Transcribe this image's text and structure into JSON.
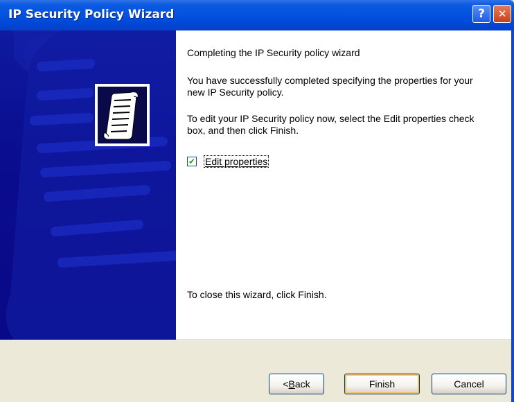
{
  "window": {
    "title": "IP Security Policy Wizard",
    "help_glyph": "?",
    "close_glyph": "✕"
  },
  "content": {
    "heading": "Completing the IP Security policy wizard",
    "paragraph1": "You have successfully completed specifying the properties for your new IP Security policy.",
    "paragraph2": "To edit your IP Security policy now, select the Edit properties check box, and then click Finish.",
    "checkbox": {
      "label": "Edit properties",
      "checked": true,
      "mark": "✔"
    },
    "finish_note": "To close this wizard, click Finish."
  },
  "footer": {
    "back_prefix": "< ",
    "back_accel": "B",
    "back_rest": "ack",
    "finish_label": "Finish",
    "cancel_label": "Cancel"
  },
  "colors": {
    "titlebar": "#0554e0",
    "banner": "#0a0d8f",
    "dialog_bg": "#ece9d8"
  }
}
